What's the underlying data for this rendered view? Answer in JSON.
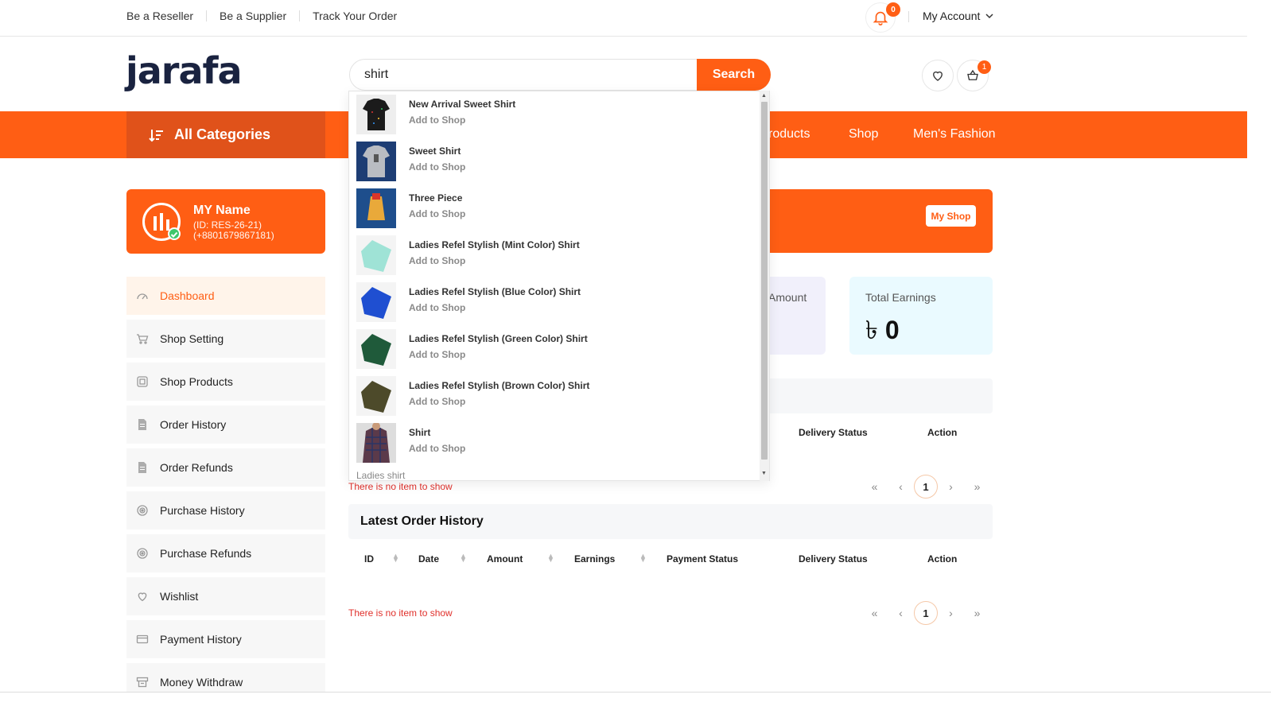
{
  "topbar": {
    "links": [
      "Be a Reseller",
      "Be a Supplier",
      "Track Your Order"
    ],
    "notification_count": "0",
    "account_label": "My Account"
  },
  "header": {
    "logo_text": "jarafa",
    "search_value": "shirt",
    "search_button": "Search",
    "cart_count": "1"
  },
  "nav": {
    "all_categories": "All Categories",
    "links": [
      "roducts",
      "Shop",
      "Men's Fashion"
    ]
  },
  "profile": {
    "name": "MY Name",
    "id": "(ID: RES-26-21)",
    "phone": "(+8801679867181)"
  },
  "sidebar": {
    "items": [
      {
        "label": "Dashboard",
        "icon": "dashboard-icon"
      },
      {
        "label": "Shop Setting",
        "icon": "cart-icon"
      },
      {
        "label": "Shop Products",
        "icon": "box-icon"
      },
      {
        "label": "Order History",
        "icon": "document-icon"
      },
      {
        "label": "Order Refunds",
        "icon": "document-icon"
      },
      {
        "label": "Purchase History",
        "icon": "target-icon"
      },
      {
        "label": "Purchase Refunds",
        "icon": "target-icon"
      },
      {
        "label": "Wishlist",
        "icon": "heart-icon"
      },
      {
        "label": "Payment History",
        "icon": "card-icon"
      },
      {
        "label": "Money Withdraw",
        "icon": "withdraw-icon"
      }
    ]
  },
  "main": {
    "my_shop_button": "My Shop",
    "stats": [
      {
        "label": "Amount"
      },
      {
        "label": "Total Earnings",
        "currency": "৳",
        "value": "0"
      }
    ],
    "table1": {
      "headers": [
        "Delivery Status",
        "Action"
      ],
      "empty": "There is no item to show",
      "page": "1"
    },
    "latest_orders": {
      "title": "Latest Order History",
      "headers": [
        "ID",
        "Date",
        "Amount",
        "Earnings",
        "Payment Status",
        "Delivery Status",
        "Action"
      ],
      "empty": "There is no item to show",
      "page": "1"
    },
    "pager_symbols": [
      "«",
      "‹",
      "›",
      "»"
    ]
  },
  "dropdown": {
    "add_label": "Add to Shop",
    "items": [
      {
        "name": "New Arrival Sweet Shirt",
        "color": "#1b1b1b"
      },
      {
        "name": "Sweet Shirt",
        "color": "#b9bcc2"
      },
      {
        "name": "Three Piece",
        "color": "#1e4e8c"
      },
      {
        "name": "Ladies Refel Stylish (Mint Color) Shirt",
        "color": "#9fe3d6"
      },
      {
        "name": "Ladies Refel Stylish (Blue Color) Shirt",
        "color": "#1f4fd1"
      },
      {
        "name": "Ladies Refel Stylish (Green Color) Shirt",
        "color": "#1f5a3a"
      },
      {
        "name": "Ladies Refel Stylish (Brown Color) Shirt",
        "color": "#4d4a2a"
      },
      {
        "name": "Shirt",
        "color": "#5b3a4a"
      }
    ],
    "suggestion": "Ladies shirt"
  },
  "colors": {
    "accent": "#ff5e14",
    "stat_bg_1": "#f1f0fb",
    "stat_bg_2": "#eafaff"
  }
}
